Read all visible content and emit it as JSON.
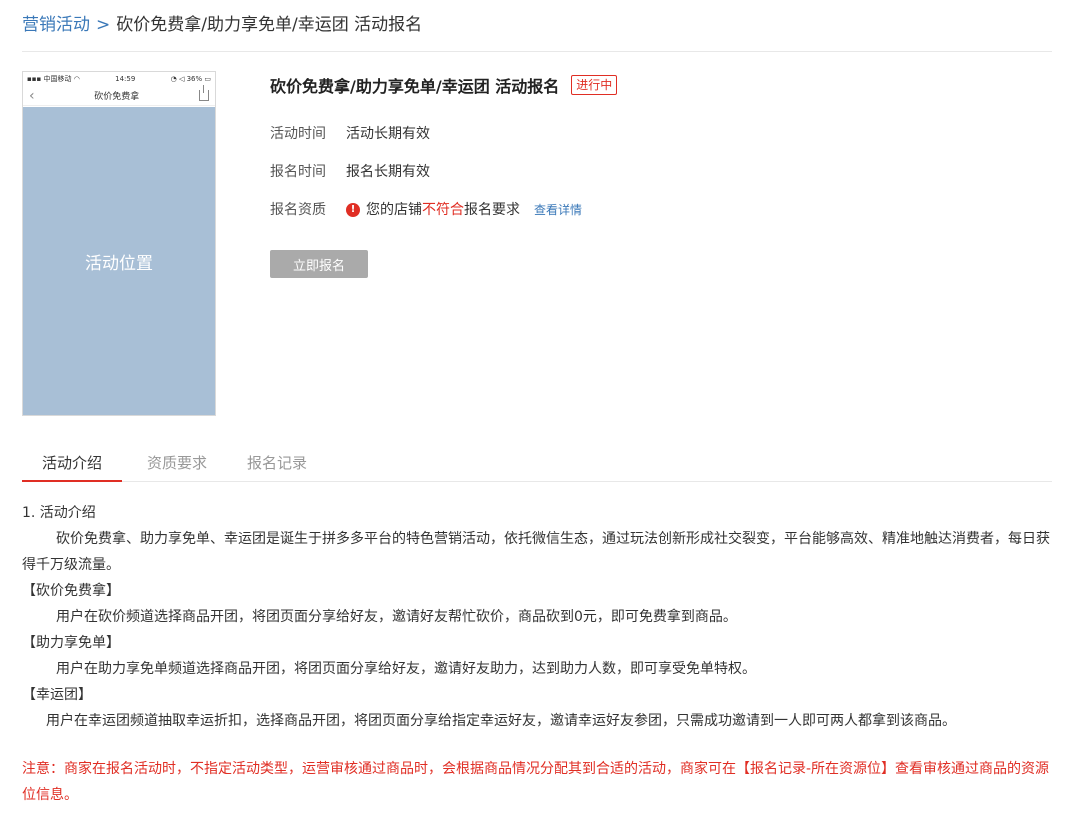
{
  "breadcrumb": {
    "parent": "营销活动",
    "separator": ">",
    "current": "砍价免费拿/助力享免单/幸运团 活动报名"
  },
  "phone_preview": {
    "carrier": "中国移动",
    "time": "14:59",
    "battery": "36%",
    "nav_title": "砍价免费拿",
    "placeholder": "活动位置"
  },
  "activity": {
    "title": "砍价免费拿/助力享免单/幸运团  活动报名",
    "status": "进行中",
    "rows": [
      {
        "label": "活动时间",
        "value": "活动长期有效"
      },
      {
        "label": "报名时间",
        "value": "报名长期有效"
      }
    ],
    "qualification": {
      "label": "报名资质",
      "prefix": "您的店铺",
      "highlight": "不符合",
      "suffix": "报名要求",
      "link": "查看详情"
    },
    "apply_button": "立即报名"
  },
  "tabs": [
    {
      "label": "活动介绍",
      "active": true
    },
    {
      "label": "资质要求",
      "active": false
    },
    {
      "label": "报名记录",
      "active": false
    }
  ],
  "intro": {
    "heading": "1. 活动介绍",
    "summary": "砍价免费拿、助力享免单、幸运团是诞生于拼多多平台的特色营销活动，依托微信生态，通过玩法创新形成社交裂变，平台能够高效、精准地触达消费者，每日获得千万级流量。",
    "sections": [
      {
        "title": "【砍价免费拿】",
        "text": "用户在砍价频道选择商品开团，将团页面分享给好友，邀请好友帮忙砍价，商品砍到0元，即可免费拿到商品。"
      },
      {
        "title": "【助力享免单】",
        "text": "用户在助力享免单频道选择商品开团，将团页面分享给好友，邀请好友助力，达到助力人数，即可享受免单特权。"
      },
      {
        "title": "【幸运团】",
        "text": "用户在幸运团频道抽取幸运折扣，选择商品开团，将团页面分享给指定幸运好友，邀请幸运好友参团，只需成功邀请到一人即可两人都拿到该商品。"
      }
    ],
    "notice": "注意：商家在报名活动时，不指定活动类型，运营审核通过商品时，会根据商品情况分配其到合适的活动，商家可在【报名记录-所在资源位】查看审核通过商品的资源位信息。"
  }
}
